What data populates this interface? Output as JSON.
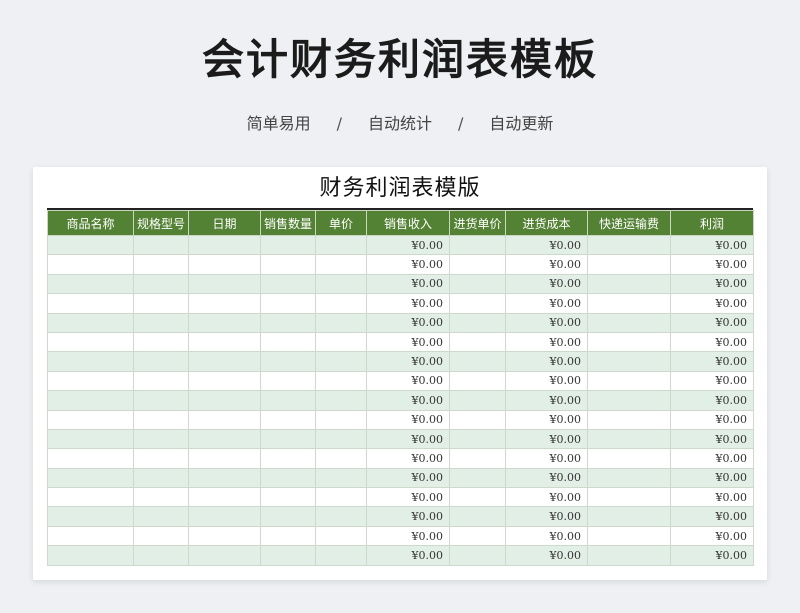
{
  "header": {
    "title": "会计财务利润表模板",
    "features": [
      "简单易用",
      "自动统计",
      "自动更新"
    ],
    "separator": "/"
  },
  "sheet": {
    "title": "财务利润表模版",
    "columns": [
      "商品名称",
      "规格型号",
      "日期",
      "销售数量",
      "单价",
      "销售收入",
      "进货单价",
      "进货成本",
      "快递运输费",
      "利润"
    ],
    "rows": [
      [
        "",
        "",
        "",
        "",
        "",
        "¥0.00",
        "",
        "¥0.00",
        "",
        "¥0.00"
      ],
      [
        "",
        "",
        "",
        "",
        "",
        "¥0.00",
        "",
        "¥0.00",
        "",
        "¥0.00"
      ],
      [
        "",
        "",
        "",
        "",
        "",
        "¥0.00",
        "",
        "¥0.00",
        "",
        "¥0.00"
      ],
      [
        "",
        "",
        "",
        "",
        "",
        "¥0.00",
        "",
        "¥0.00",
        "",
        "¥0.00"
      ],
      [
        "",
        "",
        "",
        "",
        "",
        "¥0.00",
        "",
        "¥0.00",
        "",
        "¥0.00"
      ],
      [
        "",
        "",
        "",
        "",
        "",
        "¥0.00",
        "",
        "¥0.00",
        "",
        "¥0.00"
      ],
      [
        "",
        "",
        "",
        "",
        "",
        "¥0.00",
        "",
        "¥0.00",
        "",
        "¥0.00"
      ],
      [
        "",
        "",
        "",
        "",
        "",
        "¥0.00",
        "",
        "¥0.00",
        "",
        "¥0.00"
      ],
      [
        "",
        "",
        "",
        "",
        "",
        "¥0.00",
        "",
        "¥0.00",
        "",
        "¥0.00"
      ],
      [
        "",
        "",
        "",
        "",
        "",
        "¥0.00",
        "",
        "¥0.00",
        "",
        "¥0.00"
      ],
      [
        "",
        "",
        "",
        "",
        "",
        "¥0.00",
        "",
        "¥0.00",
        "",
        "¥0.00"
      ],
      [
        "",
        "",
        "",
        "",
        "",
        "¥0.00",
        "",
        "¥0.00",
        "",
        "¥0.00"
      ],
      [
        "",
        "",
        "",
        "",
        "",
        "¥0.00",
        "",
        "¥0.00",
        "",
        "¥0.00"
      ],
      [
        "",
        "",
        "",
        "",
        "",
        "¥0.00",
        "",
        "¥0.00",
        "",
        "¥0.00"
      ],
      [
        "",
        "",
        "",
        "",
        "",
        "¥0.00",
        "",
        "¥0.00",
        "",
        "¥0.00"
      ],
      [
        "",
        "",
        "",
        "",
        "",
        "¥0.00",
        "",
        "¥0.00",
        "",
        "¥0.00"
      ],
      [
        "",
        "",
        "",
        "",
        "",
        "¥0.00",
        "",
        "¥0.00",
        "",
        "¥0.00"
      ]
    ]
  },
  "colors": {
    "header_green": "#548235",
    "row_band": "#e2efe6",
    "page_background": "#eef0f3"
  }
}
